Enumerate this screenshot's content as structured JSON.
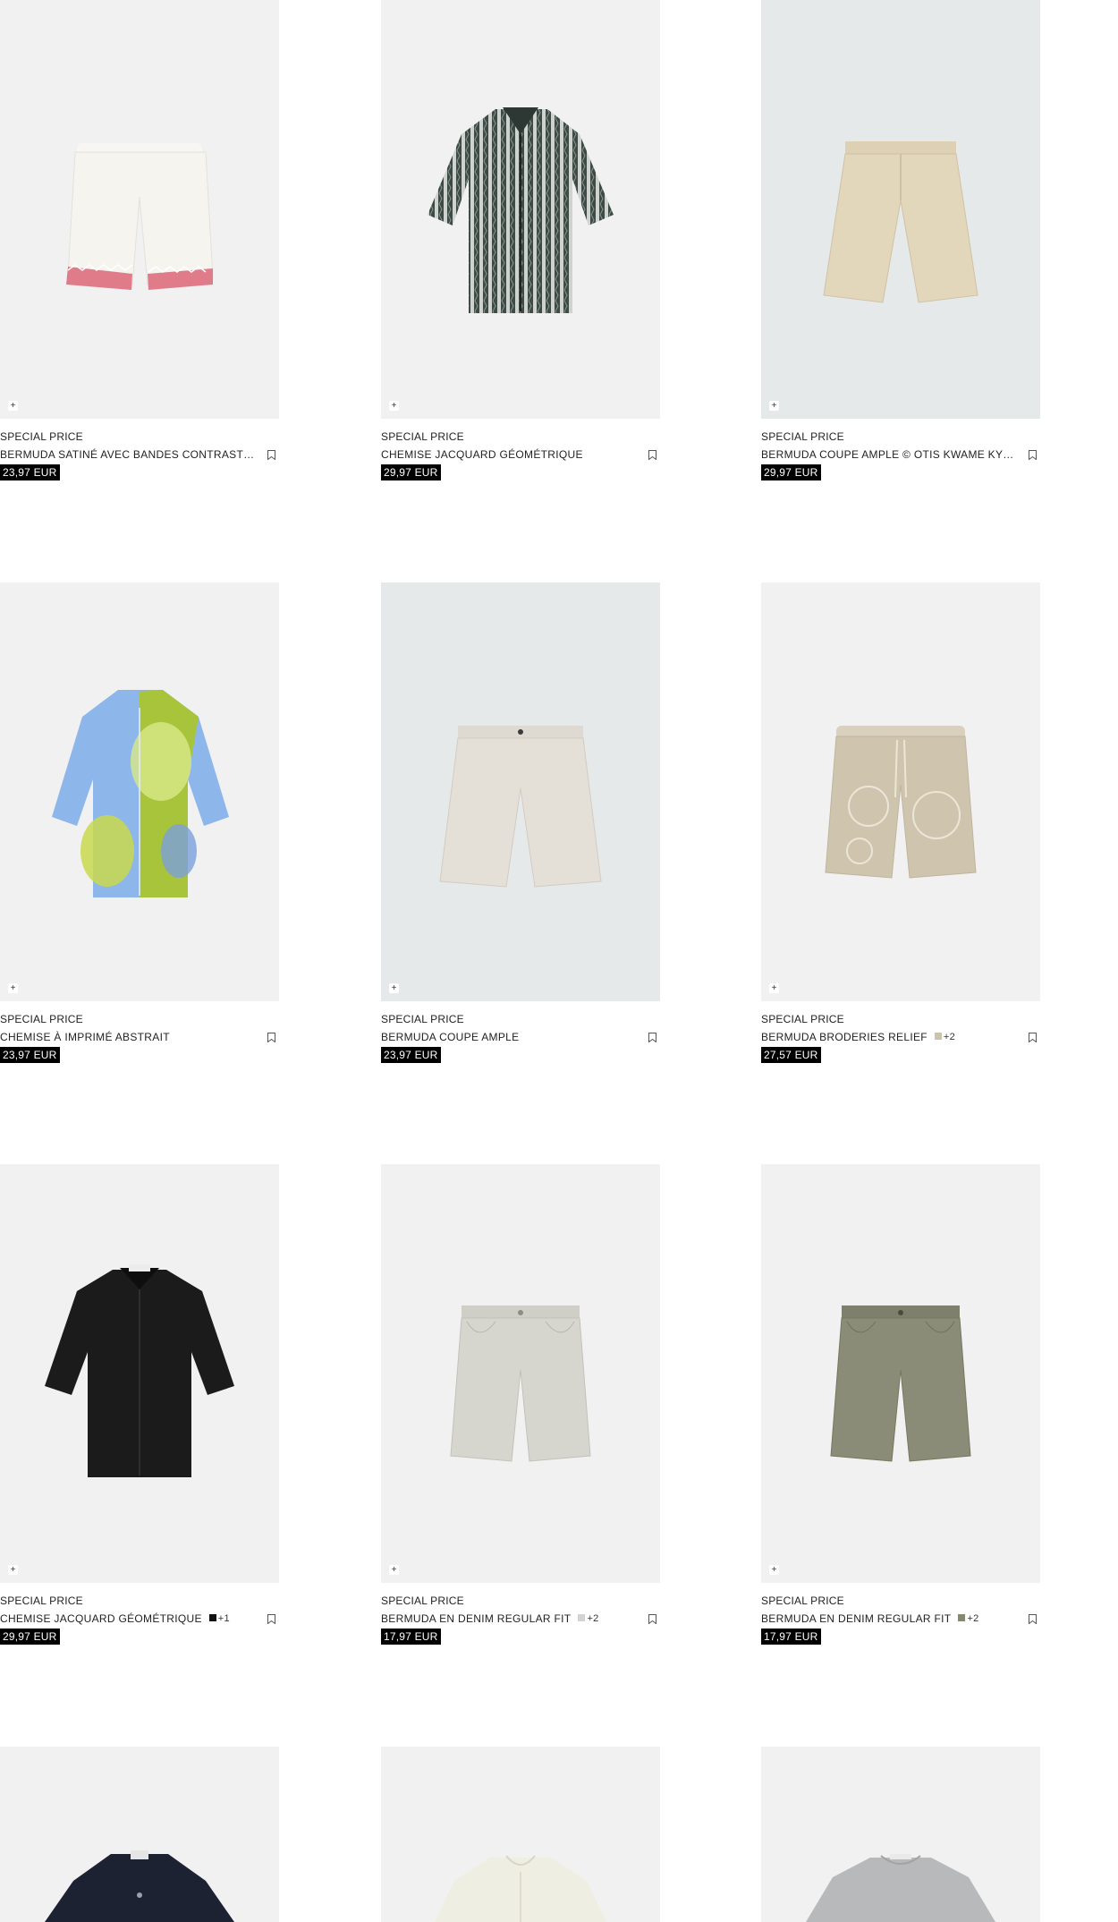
{
  "products": [
    {
      "tag": "SPECIAL PRICE",
      "name": "BERMUDA SATINÉ AVEC BANDES CONTRASTÉES",
      "price": "23,97 EUR",
      "swatch_color": "",
      "swatch_extra": "",
      "bg": "#f1f1f1",
      "icon": "bermuda-satin-image"
    },
    {
      "tag": "SPECIAL PRICE",
      "name": "CHEMISE JACQUARD GÉOMÉTRIQUE",
      "price": "29,97 EUR",
      "swatch_color": "",
      "swatch_extra": "",
      "bg": "#f1f1f1",
      "icon": "jacquard-shirt-image"
    },
    {
      "tag": "SPECIAL PRICE",
      "name": "BERMUDA COUPE AMPLE © OTIS KWAME KYE QUAICOE",
      "price": "29,97 EUR",
      "swatch_color": "",
      "swatch_extra": "",
      "bg": "#e6e9ea",
      "icon": "beige-bermuda-image"
    },
    {
      "tag": "SPECIAL PRICE",
      "name": "CHEMISE À IMPRIMÉ ABSTRAIT",
      "price": "23,97 EUR",
      "swatch_color": "",
      "swatch_extra": "",
      "bg": "#f1f1f1",
      "icon": "abstract-shirt-image"
    },
    {
      "tag": "SPECIAL PRICE",
      "name": "BERMUDA COUPE AMPLE",
      "price": "23,97 EUR",
      "swatch_color": "",
      "swatch_extra": "",
      "bg": "#e6e9ea",
      "icon": "ecru-bermuda-image"
    },
    {
      "tag": "SPECIAL PRICE",
      "name": "BERMUDA BRODERIES RELIEF",
      "price": "27,57 EUR",
      "swatch_color": "#c9c3b0",
      "swatch_extra": "+2",
      "bg": "#f1f1f1",
      "icon": "embroidered-bermuda-image"
    },
    {
      "tag": "SPECIAL PRICE",
      "name": "CHEMISE JACQUARD GÉOMÉTRIQUE",
      "price": "29,97 EUR",
      "swatch_color": "#111111",
      "swatch_extra": "+1",
      "bg": "#f1f1f1",
      "icon": "black-shirt-image"
    },
    {
      "tag": "SPECIAL PRICE",
      "name": "BERMUDA EN DENIM REGULAR FIT",
      "price": "17,97 EUR",
      "swatch_color": "#d3d3d0",
      "swatch_extra": "+2",
      "bg": "#f1f1f1",
      "icon": "light-denim-bermuda-image"
    },
    {
      "tag": "SPECIAL PRICE",
      "name": "BERMUDA EN DENIM REGULAR FIT",
      "price": "17,97 EUR",
      "swatch_color": "#86876f",
      "swatch_extra": "+2",
      "bg": "#f1f1f1",
      "icon": "khaki-denim-bermuda-image"
    },
    {
      "tag": "",
      "name": "",
      "price": "",
      "swatch_color": "",
      "swatch_extra": "",
      "bg": "#f1f1f1",
      "icon": "navy-shirt-image"
    },
    {
      "tag": "",
      "name": "",
      "price": "",
      "swatch_color": "",
      "swatch_extra": "",
      "bg": "#f1f1f1",
      "icon": "cream-shirt-image"
    },
    {
      "tag": "",
      "name": "",
      "price": "",
      "swatch_color": "",
      "swatch_extra": "",
      "bg": "#f1f1f1",
      "icon": "grey-tshirt-image"
    }
  ],
  "ui": {
    "quick_add_glyph": "+",
    "price_bg": "#000000",
    "price_color": "#ffffff"
  }
}
